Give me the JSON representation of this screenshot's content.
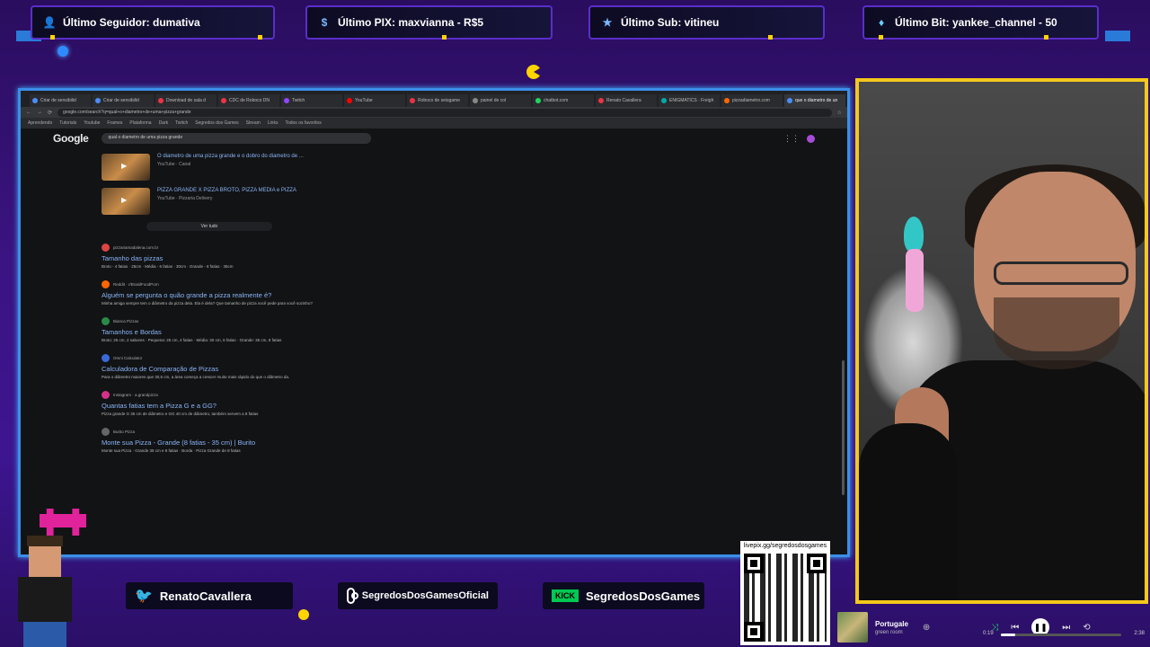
{
  "alerts": [
    {
      "label": "Último Seguidor: dumativa",
      "icon": "person-icon"
    },
    {
      "label": "Último PIX: maxvianna - R$5",
      "icon": "dollar-icon"
    },
    {
      "label": "Último Sub: vitineu",
      "icon": "star-icon"
    },
    {
      "label": "Último Bit: yankee_channel - 50",
      "icon": "diamond-icon"
    }
  ],
  "browser": {
    "tabs": [
      "Criar de sensibilid",
      "Criar de sensibilid",
      "Download de sala d",
      "CDC de Roboco DN",
      "Twitch",
      "YouTube",
      "Roboco de seisgame",
      "painel de col",
      "chatbot.com",
      "Renato Cavallera",
      "ENIGMATICS · Freigh",
      "pizzadiametro.com",
      "que o diametro de un"
    ],
    "url": "google.com/search?q=qual+o+diametro+de+uma+pizza+grande",
    "bookmarks": [
      "Aprendendo",
      "Tutorials",
      "Youtube",
      "Frames",
      "Plataforma",
      "Dark",
      "Twitch",
      "Segredos dos Games",
      "Stream",
      "Links",
      "Todos os favoritos"
    ],
    "logo": "Google",
    "search_query": "qual o diametro de uma pizza grande",
    "videos": [
      {
        "title": "O diametro de uma pizza grande e o dobro do diametro de ...",
        "sub": "YouTube · Canal"
      },
      {
        "title": "PIZZA GRANDE X PIZZA BROTO, PIZZA MEDIA e PIZZA",
        "sub": "YouTube · Pizzaria Delivery"
      }
    ],
    "see_all": "Ver tudo",
    "results": [
      {
        "title": "Tamanho das pizzas",
        "source": "pizzariamadalena.com.br",
        "snippet": "Broto - 4 fatias · 25cm · Média - 6 fatias · 30cm · Grande - 8 fatias · 35cm",
        "color": "#d44"
      },
      {
        "title": "Alguém se pergunta o quão grande a pizza realmente é?",
        "source": "Reddit · r/BrasilFoodPorn",
        "snippet": "Minha amiga sempre tem o diâmetro da pizza dela. Ela é dela? Que tamanho de pizza você pede para você sozinho?",
        "color": "#f60"
      },
      {
        "title": "Tamanhos e Bordas",
        "source": "Bianca Pizzas",
        "snippet": "Broto: 25 cm, 2 sabores · Pequena: 25 cm, 4 fatias · Média: 30 cm, 6 fatias · Grande: 35 cm, 8 fatias",
        "color": "#2a8a4a"
      },
      {
        "title": "Calculadora de Comparação de Pizzas",
        "source": "Omni Calculator",
        "snippet": "Para o diâmetro maiores que 30,5 cm, a área começa a crescer muito mais rápido do que o diâmetro da.",
        "color": "#3a6ad8"
      },
      {
        "title": "Quantas fatias tem a Pizza G e a GG?",
        "source": "Instagram · a.grandpizza",
        "snippet": "Pizza grande G 35 cm de diâmetro e GG 40 cm de diâmetro, também servem a 8 fatias",
        "color": "#d4308a"
      },
      {
        "title": "Monte sua Pizza - Grande (8 fatias - 35 cm) | Burito",
        "source": "Burito Pizza",
        "snippet": "Monte sua Pizza · Grande 35 cm e 8 fatias · Borda · Pizza Grande de 8 fatias",
        "color": "#666"
      }
    ]
  },
  "social": {
    "twitter": "RenatoCavallera",
    "instagram": "SegredosDosGamesOficial",
    "kick_badge": "KICK",
    "kick": "SegredosDosGames"
  },
  "qr_label": "livepix.gg/segredosdosgames",
  "player": {
    "title": "Portugale",
    "artist": "green room",
    "current": "0:19",
    "duration": "2:38",
    "progress": 0.12
  },
  "colors": {
    "frame": "#3b8fe8",
    "cam_border": "#f4c81c",
    "accent_purple": "#5a2ec9"
  }
}
